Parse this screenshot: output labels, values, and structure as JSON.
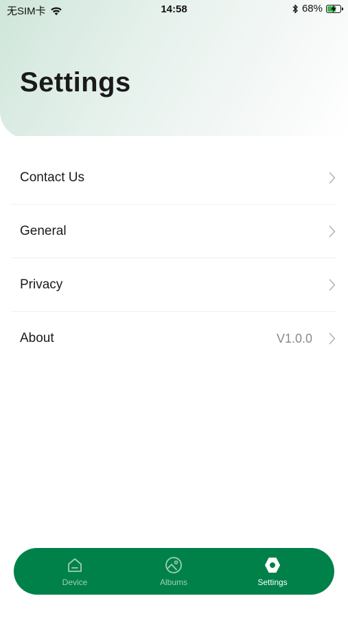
{
  "status_bar": {
    "carrier": "无SIM卡",
    "time": "14:58",
    "battery_percent": "68%",
    "battery_level": 0.68
  },
  "header": {
    "title": "Settings"
  },
  "settings": {
    "items": [
      {
        "label": "Contact Us",
        "value": ""
      },
      {
        "label": "General",
        "value": ""
      },
      {
        "label": "Privacy",
        "value": ""
      },
      {
        "label": "About",
        "value": "V1.0.0"
      }
    ]
  },
  "tab_bar": {
    "tabs": [
      {
        "label": "Device",
        "icon": "home-icon"
      },
      {
        "label": "Albums",
        "icon": "albums-icon"
      },
      {
        "label": "Settings",
        "icon": "settings-icon"
      }
    ],
    "active": "Settings"
  },
  "colors": {
    "accent": "#00814a",
    "inactive_tab_text": "#9fd0b6",
    "battery_green": "#3bb54a",
    "value_text": "#8a8a8a"
  }
}
